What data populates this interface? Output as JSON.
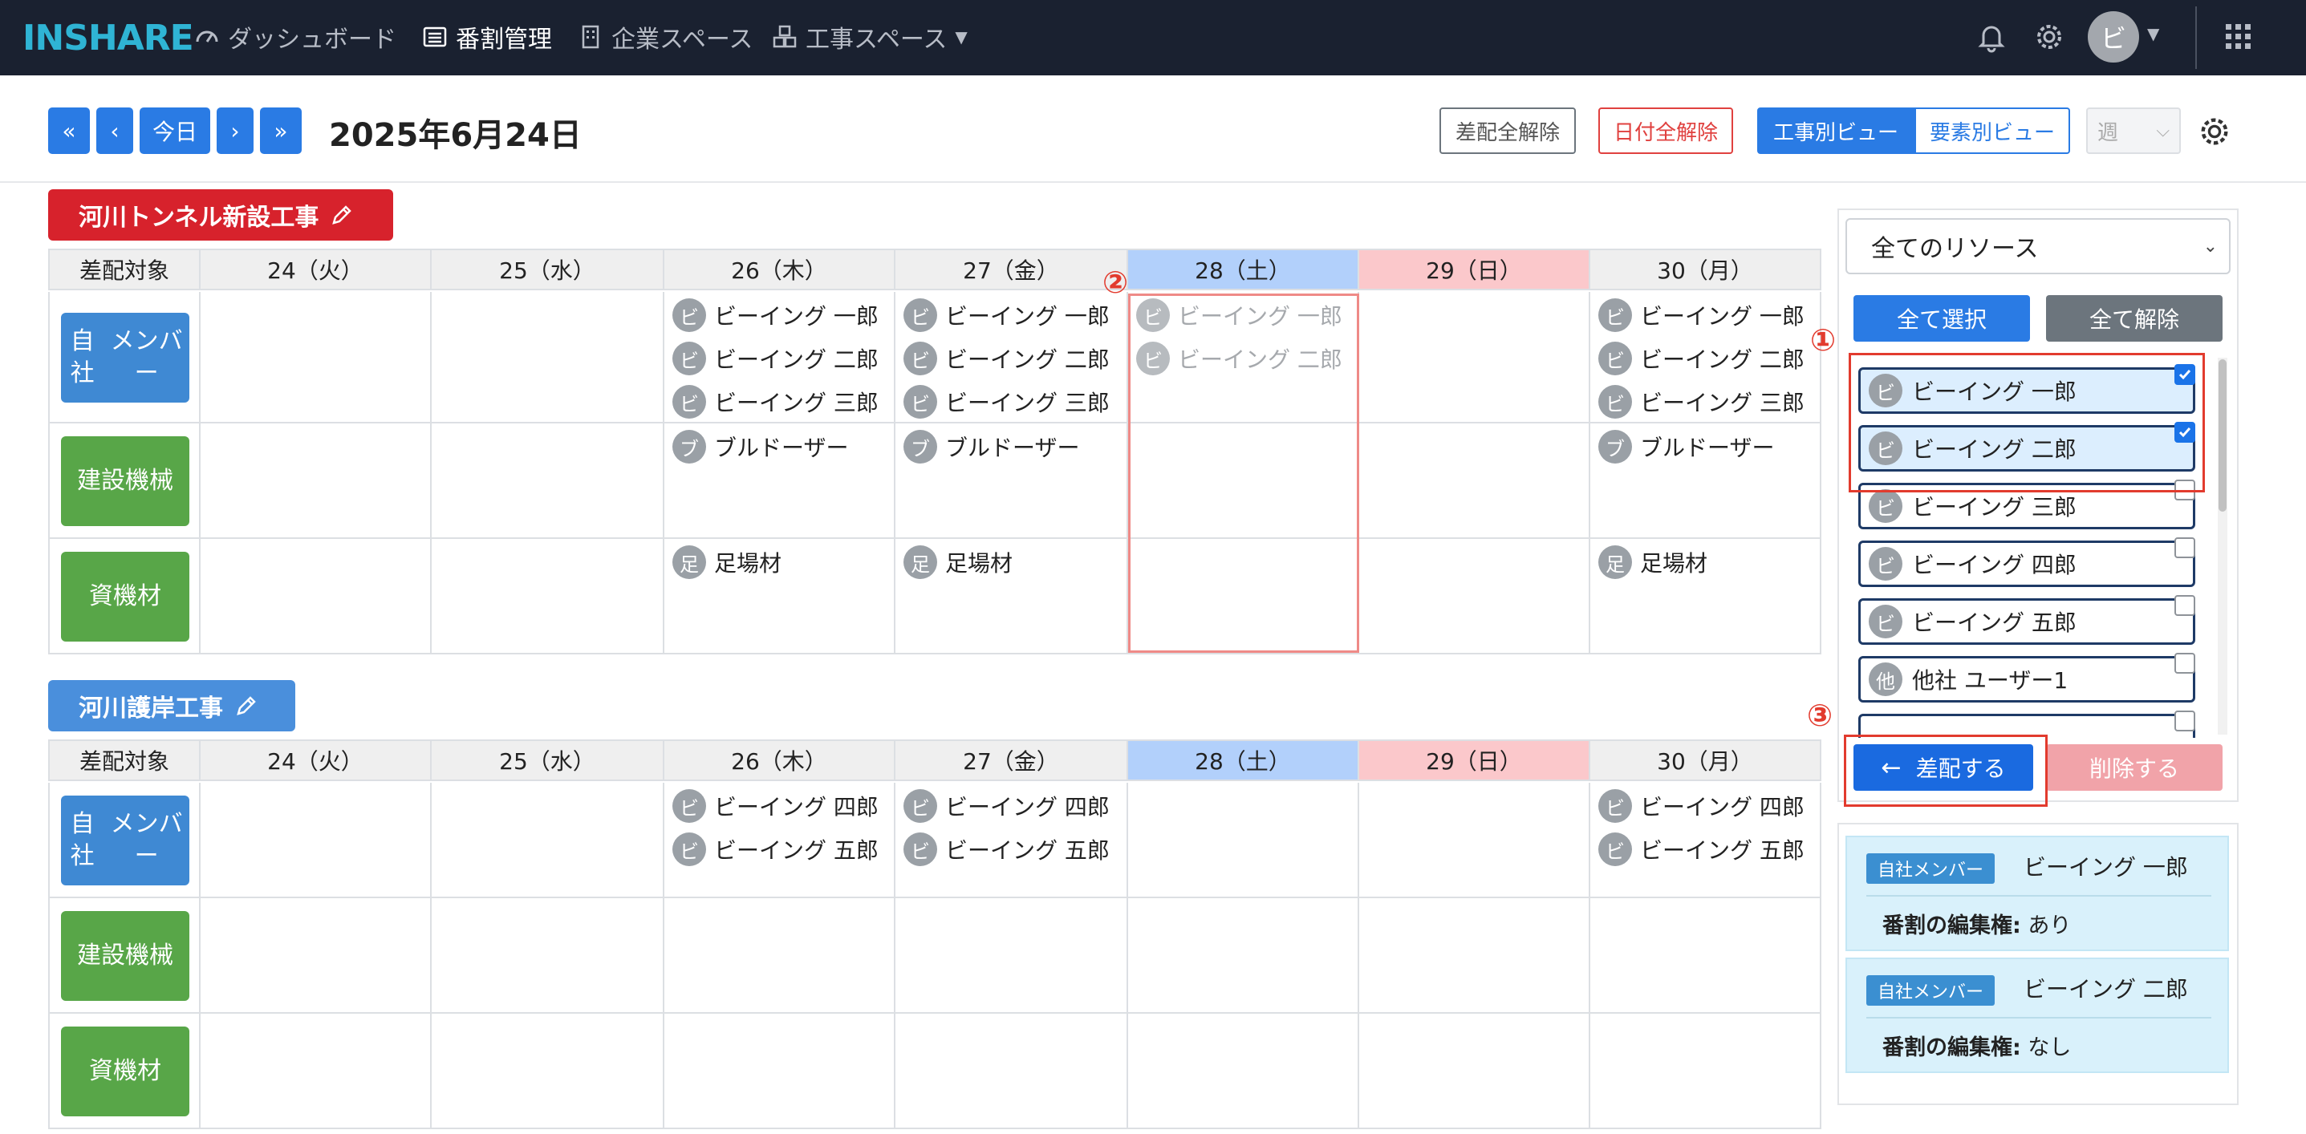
{
  "navbar": {
    "logo": "INSHARE",
    "items": [
      {
        "label": "ダッシュボード"
      },
      {
        "label": "番割管理"
      },
      {
        "label": "企業スペース"
      },
      {
        "label": "工事スペース"
      }
    ],
    "avatar": "ビ"
  },
  "toolbar": {
    "first": "«",
    "prev": "‹",
    "today": "今日",
    "next": "›",
    "last": "»",
    "date": "2025年6月24日",
    "clear_dispatch": "差配全解除",
    "clear_dates": "日付全解除",
    "view_by_project": "工事別ビュー",
    "view_by_element": "要素別ビュー",
    "period": "週"
  },
  "days": [
    "24（火）",
    "25（水）",
    "26（木）",
    "27（金）",
    "28（土）",
    "29（日）",
    "30（月）"
  ],
  "target_header": "差配対象",
  "projects": [
    {
      "name": "河川トンネル新設工事",
      "rows": [
        {
          "label": "自社メンバー",
          "label_lines": [
            "自社",
            "メンバー"
          ],
          "cells": [
            [],
            [],
            [
              {
                "i": "ビ",
                "n": "ビーイング 一郎"
              },
              {
                "i": "ビ",
                "n": "ビーイング 二郎"
              },
              {
                "i": "ビ",
                "n": "ビーイング 三郎"
              }
            ],
            [
              {
                "i": "ビ",
                "n": "ビーイング 一郎"
              },
              {
                "i": "ビ",
                "n": "ビーイング 二郎"
              },
              {
                "i": "ビ",
                "n": "ビーイング 三郎"
              }
            ],
            [
              {
                "i": "ビ",
                "n": "ビーイング 一郎"
              },
              {
                "i": "ビ",
                "n": "ビーイング 二郎"
              }
            ],
            [],
            [
              {
                "i": "ビ",
                "n": "ビーイング 一郎"
              },
              {
                "i": "ビ",
                "n": "ビーイング 二郎"
              },
              {
                "i": "ビ",
                "n": "ビーイング 三郎"
              }
            ]
          ]
        },
        {
          "label": "建設機械",
          "label_lines": [
            "建設機械"
          ],
          "cells": [
            [],
            [],
            [
              {
                "i": "ブ",
                "n": "ブルドーザー"
              }
            ],
            [
              {
                "i": "ブ",
                "n": "ブルドーザー"
              }
            ],
            [],
            [],
            [
              {
                "i": "ブ",
                "n": "ブルドーザー"
              }
            ]
          ]
        },
        {
          "label": "資機材",
          "label_lines": [
            "資機材"
          ],
          "cells": [
            [],
            [],
            [
              {
                "i": "足",
                "n": "足場材"
              }
            ],
            [
              {
                "i": "足",
                "n": "足場材"
              }
            ],
            [],
            [],
            [
              {
                "i": "足",
                "n": "足場材"
              }
            ]
          ]
        }
      ]
    },
    {
      "name": "河川護岸工事",
      "rows": [
        {
          "label": "自社メンバー",
          "label_lines": [
            "自社",
            "メンバー"
          ],
          "cells": [
            [],
            [],
            [
              {
                "i": "ビ",
                "n": "ビーイング 四郎"
              },
              {
                "i": "ビ",
                "n": "ビーイング 五郎"
              }
            ],
            [
              {
                "i": "ビ",
                "n": "ビーイング 四郎"
              },
              {
                "i": "ビ",
                "n": "ビーイング 五郎"
              }
            ],
            [],
            [],
            [
              {
                "i": "ビ",
                "n": "ビーイング 四郎"
              },
              {
                "i": "ビ",
                "n": "ビーイング 五郎"
              }
            ]
          ]
        },
        {
          "label": "建設機械",
          "label_lines": [
            "建設機械"
          ],
          "cells": [
            [],
            [],
            [],
            [],
            [],
            [],
            []
          ]
        },
        {
          "label": "資機材",
          "label_lines": [
            "資機材"
          ],
          "cells": [
            [],
            [],
            [],
            [],
            [],
            [],
            []
          ]
        }
      ]
    }
  ],
  "sidebar": {
    "resource_filter": "全てのリソース",
    "select_all": "全て選択",
    "deselect_all": "全て解除",
    "resources": [
      {
        "i": "ビ",
        "n": "ビーイング 一郎",
        "checked": true
      },
      {
        "i": "ビ",
        "n": "ビーイング 二郎",
        "checked": true
      },
      {
        "i": "ビ",
        "n": "ビーイング 三郎",
        "checked": false
      },
      {
        "i": "ビ",
        "n": "ビーイング 四郎",
        "checked": false
      },
      {
        "i": "ビ",
        "n": "ビーイング 五郎",
        "checked": false
      },
      {
        "i": "他",
        "n": "他社 ユーザー1",
        "checked": false
      }
    ],
    "dispatch": "差配する",
    "delete": "削除する",
    "info": [
      {
        "badge": "自社メンバー",
        "name": "ビーイング 一郎",
        "perm_label": "番割の編集権:",
        "perm_value": "あり"
      },
      {
        "badge": "自社メンバー",
        "name": "ビーイング 二郎",
        "perm_label": "番割の編集権:",
        "perm_value": "なし"
      }
    ]
  },
  "annotations": [
    "①",
    "②",
    "③"
  ],
  "colors": {
    "navbar": "#1a2130",
    "primary": "#2a7be4",
    "project1": "#d7222c",
    "project2": "#4a8fdc",
    "members": "#3f89d3",
    "machinery": "#58a648",
    "materials": "#58a648",
    "saturday": "#b2d0fb",
    "sunday": "#fbc8cb",
    "annotation": "#e23b2e"
  }
}
